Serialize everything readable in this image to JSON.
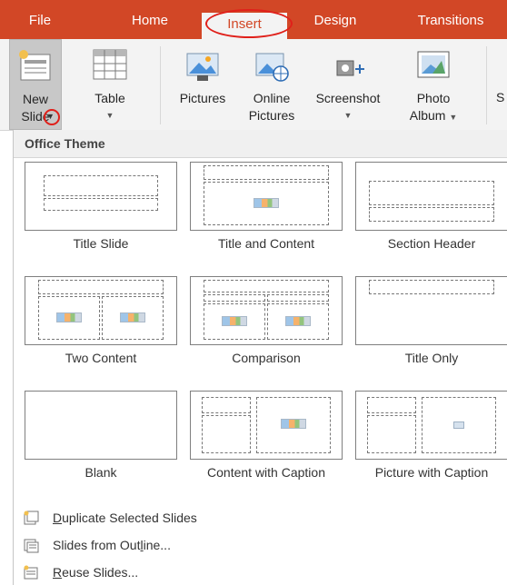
{
  "tabs": [
    {
      "label": "File",
      "active": false
    },
    {
      "label": "Home",
      "active": false
    },
    {
      "label": "Insert",
      "active": true
    },
    {
      "label": "Design",
      "active": false
    },
    {
      "label": "Transitions",
      "active": false
    }
  ],
  "ribbon": {
    "new_slide": {
      "line1": "New",
      "line2": "Slide"
    },
    "table": {
      "line1": "Table"
    },
    "pictures": {
      "line1": "Pictures"
    },
    "online_pictures": {
      "line1": "Online",
      "line2": "Pictures"
    },
    "screenshot": {
      "line1": "Screenshot"
    },
    "photo_album": {
      "line1": "Photo",
      "line2": "Album"
    },
    "cut_off": "S"
  },
  "gallery": {
    "section_title": "Office Theme",
    "layouts": [
      {
        "name": "Title Slide"
      },
      {
        "name": "Title and Content"
      },
      {
        "name": "Section Header"
      },
      {
        "name": "Two Content"
      },
      {
        "name": "Comparison"
      },
      {
        "name": "Title Only"
      },
      {
        "name": "Blank"
      },
      {
        "name": "Content with Caption"
      },
      {
        "name": "Picture with Caption"
      }
    ]
  },
  "commands": [
    {
      "accel": "D",
      "rest": "uplicate Selected Slides"
    },
    {
      "before": "Slides from Out",
      "accel": "l",
      "after": "ine..."
    },
    {
      "accel": "R",
      "rest": "euse Slides..."
    }
  ],
  "colors": {
    "accent": "#d24726",
    "annotation": "#e0201a"
  }
}
